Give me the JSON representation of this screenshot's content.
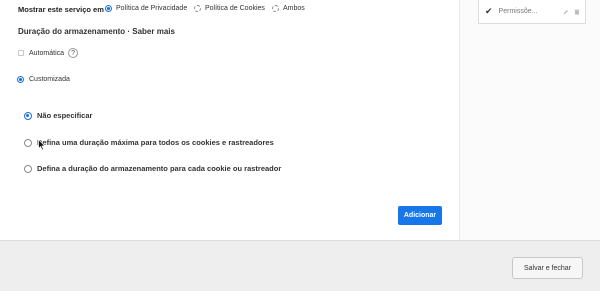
{
  "show_service": {
    "label": "Mostrar este serviço em",
    "options": [
      {
        "label": "Política de Privacidade",
        "selected": true
      },
      {
        "label": "Política de Cookies",
        "selected": false
      },
      {
        "label": "Ambos",
        "selected": false
      }
    ]
  },
  "storage": {
    "title": "Duração do armazenamento · Saber mais",
    "automatic_label": "Automática",
    "help_symbol": "?",
    "custom_label": "Customizada",
    "suboptions": [
      {
        "label": "Não especificar",
        "selected": true
      },
      {
        "label": "Defina uma duração máxima para todos os cookies e rastreadores",
        "selected": false
      },
      {
        "label": "Defina a duração do armazenamento para cada cookie ou rastreador",
        "selected": false
      }
    ]
  },
  "add_button": "Adicionar",
  "sidebar": {
    "card_label": "Permissõe...",
    "icons": [
      "check-icon",
      "pencil-icon",
      "trash-icon"
    ]
  },
  "footer": {
    "save_close": "Salvar e fechar"
  },
  "colors": {
    "accent": "#1877e8",
    "footer_bg": "#eeeeee"
  }
}
